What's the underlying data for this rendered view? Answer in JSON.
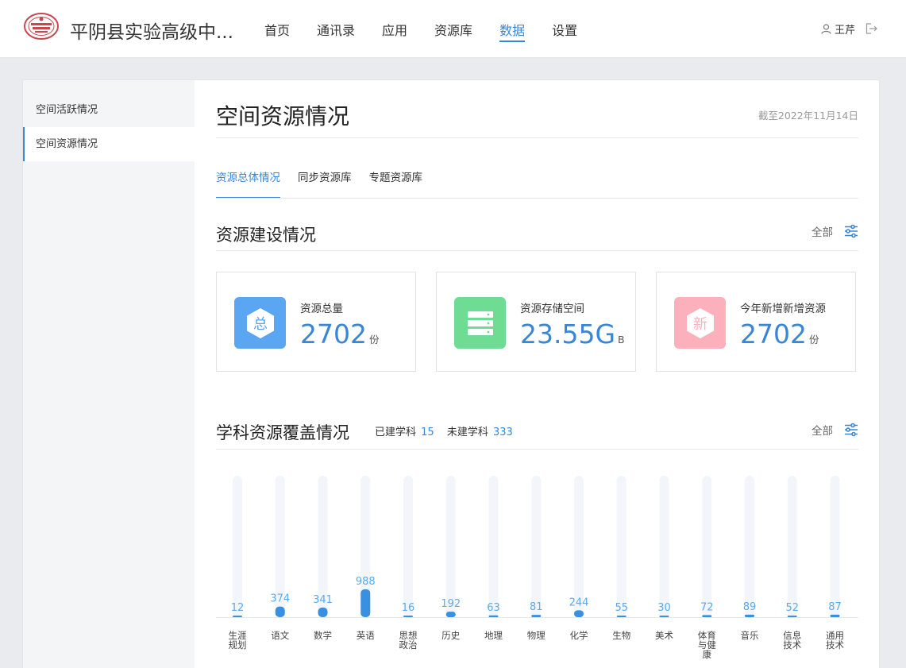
{
  "header": {
    "school_name": "平阴县实验高级中...",
    "nav": [
      "首页",
      "通讯录",
      "应用",
      "资源库",
      "数据",
      "设置"
    ],
    "active_nav": 4,
    "user_name": "王芹"
  },
  "sidebar": {
    "items": [
      {
        "label": "空间活跃情况"
      },
      {
        "label": "空间资源情况"
      }
    ]
  },
  "main": {
    "title": "空间资源情况",
    "as_of": "截至2022年11月14日",
    "tabs": [
      "资源总体情况",
      "同步资源库",
      "专题资源库"
    ],
    "build": {
      "title": "资源建设情况",
      "filter_label": "全部",
      "cards": [
        {
          "label": "资源总量",
          "value": "2702",
          "unit": "份",
          "icon_char": "总",
          "color": "#5aa6f3"
        },
        {
          "label": "资源存储空间",
          "value": "23.55G",
          "unit": "B",
          "icon_char": "",
          "color": "#6fdc94"
        },
        {
          "label": "今年新增新增资源",
          "value": "2702",
          "unit": "份",
          "icon_char": "新",
          "color": "#fbb0bc"
        }
      ]
    },
    "coverage": {
      "title": "学科资源覆盖情况",
      "built_label": "已建学科",
      "built_count": "15",
      "unbuilt_label": "未建学科",
      "unbuilt_count": "333",
      "filter_label": "全部"
    }
  },
  "chart_data": {
    "type": "bar",
    "categories": [
      "生涯规划",
      "语文",
      "数学",
      "英语",
      "思想政治",
      "历史",
      "地理",
      "物理",
      "化学",
      "生物",
      "美术",
      "体育与健康",
      "音乐",
      "信息技术",
      "通用技术"
    ],
    "category_lines": [
      [
        "生涯",
        "规划"
      ],
      [
        "语文"
      ],
      [
        "数学"
      ],
      [
        "英语"
      ],
      [
        "思想",
        "政治"
      ],
      [
        "历史"
      ],
      [
        "地理"
      ],
      [
        "物理"
      ],
      [
        "化学"
      ],
      [
        "生物"
      ],
      [
        "美术"
      ],
      [
        "体育",
        "与健",
        "康"
      ],
      [
        "音乐"
      ],
      [
        "信息",
        "技术"
      ],
      [
        "通用",
        "技术"
      ]
    ],
    "values": [
      12,
      374,
      341,
      988,
      16,
      192,
      63,
      81,
      244,
      55,
      30,
      72,
      89,
      52,
      87
    ],
    "ylim": [
      0,
      5000
    ],
    "bar_color": "#3a90e0",
    "track_color": "#f2f6fa",
    "label_color": "#5aaaf0"
  }
}
